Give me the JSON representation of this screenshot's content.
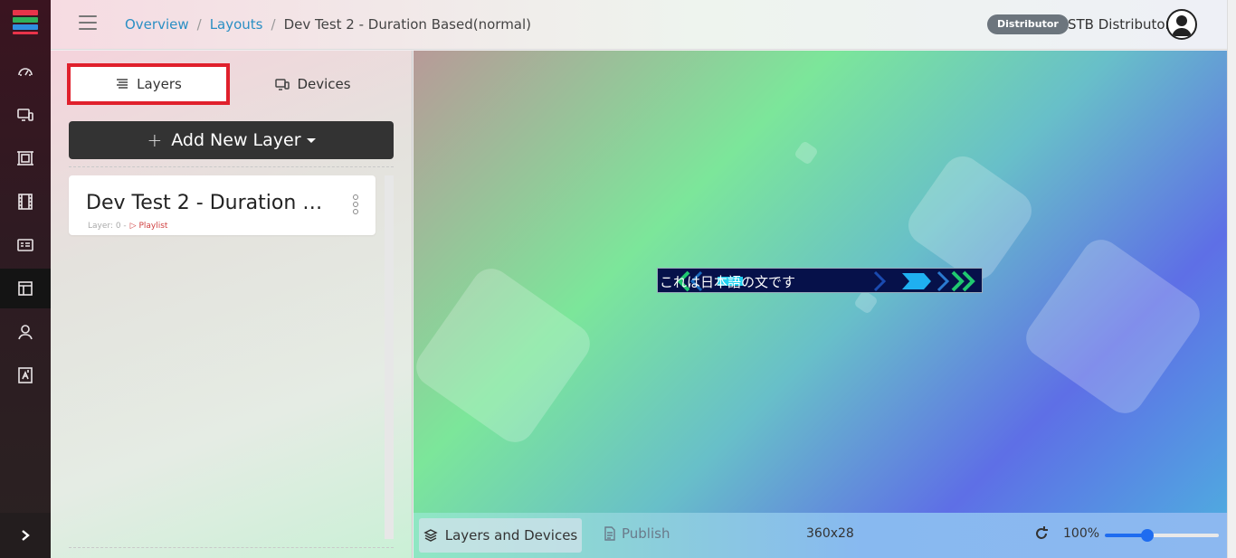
{
  "app": {
    "logo_colors": [
      "#e8344a",
      "#2fb15b",
      "#2f8fe0",
      "#e8344a"
    ]
  },
  "sidebar": {
    "items": [
      {
        "icon": "dashboard-gauge-icon"
      },
      {
        "icon": "devices-icon"
      },
      {
        "icon": "media-frame-icon"
      },
      {
        "icon": "film-icon"
      },
      {
        "icon": "playlist-card-icon"
      },
      {
        "icon": "layouts-icon",
        "active": true
      },
      {
        "icon": "users-icon"
      },
      {
        "icon": "reports-icon"
      }
    ],
    "expand_icon": "chevron-right-icon"
  },
  "header": {
    "breadcrumb": {
      "overview": "Overview",
      "layouts": "Layouts",
      "current": "Dev Test 2 - Duration Based(normal)"
    },
    "role_badge": "Distributor",
    "user_name": "STB Distributor"
  },
  "panel": {
    "tabs": {
      "layers": "Layers",
      "devices": "Devices"
    },
    "add_layer_label": "Add New Layer",
    "layers": [
      {
        "name": "Dev Test 2 - Duration B...",
        "meta": "Layer: 0 -",
        "type": "Playlist"
      }
    ]
  },
  "canvas": {
    "ticker_text": "これは日本語の文です"
  },
  "toolbar": {
    "layers_devices_label": "Layers and Devices",
    "publish_label": "Publish",
    "dimensions": "360x28",
    "zoom": "100%",
    "zoom_slider_value": 0.36
  },
  "colors": {
    "accent_link": "#2b8fc4",
    "active_tab_border": "#e0202c",
    "slider": "#1e6cf0"
  }
}
